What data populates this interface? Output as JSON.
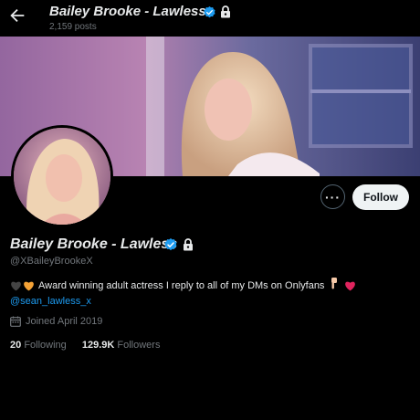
{
  "header": {
    "display_name": "Bailey Brooke - Lawless",
    "posts_count": "2,159 posts"
  },
  "profile": {
    "display_name": "Bailey Brooke - Lawless",
    "handle": "@XBaileyBrookeX",
    "bio_text": "Award winning adult actress  I reply to all of my DMs on Onlyfans",
    "bio_mention": "@sean_lawless_x",
    "joined": "Joined April 2019",
    "following_count": "20",
    "following_label": "Following",
    "followers_count": "129.9K",
    "followers_label": "Followers"
  },
  "actions": {
    "more_label": "···",
    "follow_label": "Follow"
  },
  "icons": {
    "back": "arrow-left-icon",
    "verified": "verified-badge-icon",
    "lock": "lock-icon",
    "calendar": "calendar-icon"
  },
  "colors": {
    "background": "#000000",
    "text": "#e7e9ea",
    "secondary_text": "#71767b",
    "accent": "#1d9bf0",
    "follow_button": "#eff3f4"
  }
}
